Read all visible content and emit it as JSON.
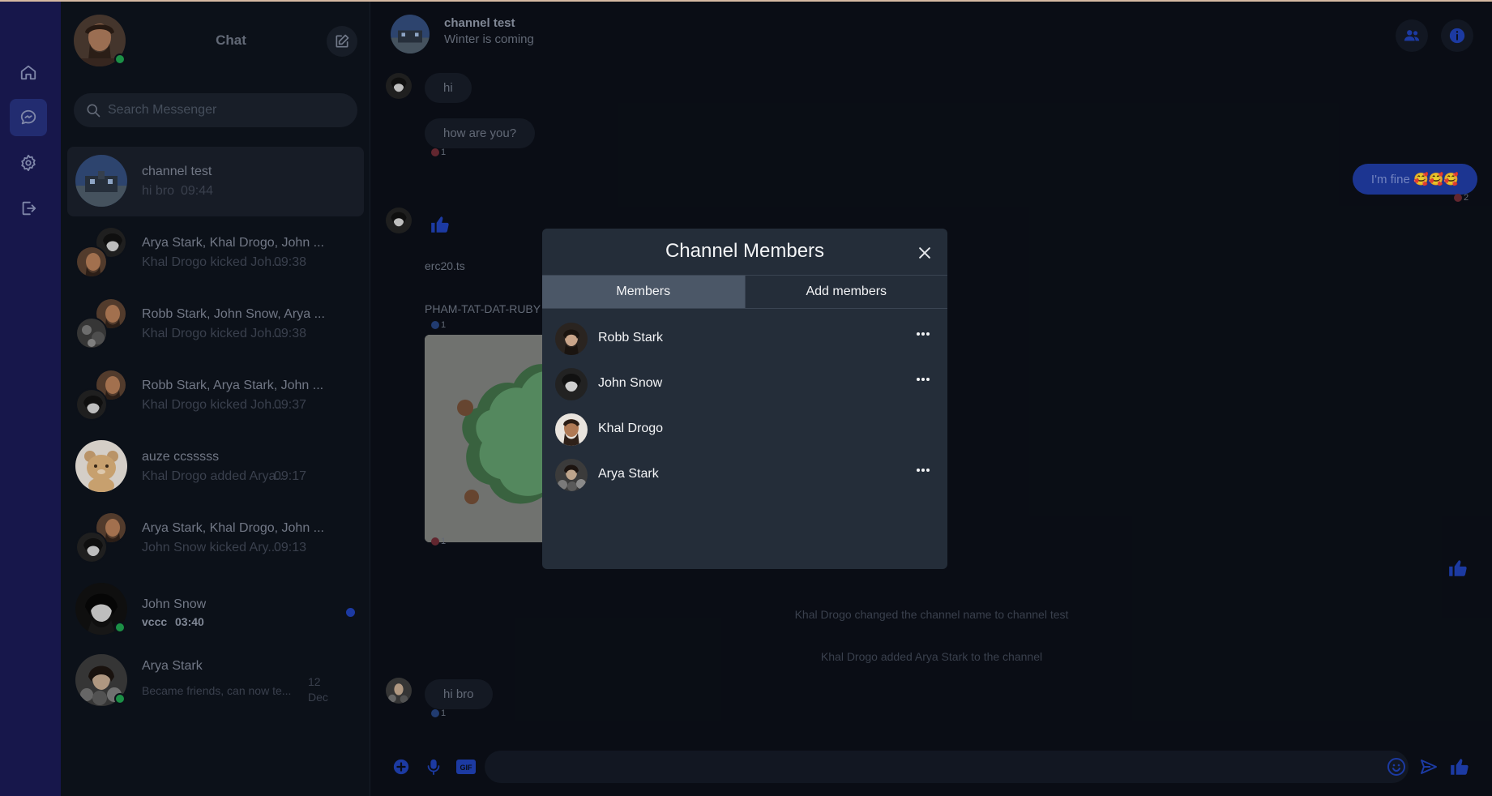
{
  "rail": {
    "items": [
      {
        "icon": "home-icon"
      },
      {
        "icon": "chat-icon",
        "active": true
      },
      {
        "icon": "gear-icon"
      },
      {
        "icon": "logout-icon"
      }
    ]
  },
  "sidebar": {
    "title": "Chat",
    "search_placeholder": "Search Messenger",
    "conversations": [
      {
        "name": "channel test",
        "last": "hi bro",
        "time": "09:44"
      },
      {
        "name": "Arya Stark, Khal Drogo, John ...",
        "last": "Khal Drogo kicked Joh...",
        "time": "09:38"
      },
      {
        "name": "Robb Stark, John Snow, Arya ...",
        "last": "Khal Drogo kicked Joh...",
        "time": "09:38"
      },
      {
        "name": "Robb Stark, Arya Stark, John ...",
        "last": "Khal Drogo kicked Joh...",
        "time": "09:37"
      },
      {
        "name": "auze ccsssss",
        "last": "Khal Drogo added Arya...",
        "time": "09:17"
      },
      {
        "name": "Arya Stark, Khal Drogo, John ...",
        "last": "John Snow kicked Ary...",
        "time": "09:13"
      },
      {
        "name": "John Snow",
        "last": "vccc",
        "time": "03:40"
      },
      {
        "name": "Arya Stark",
        "last": "Became friends, can now te...",
        "time_line1": "12",
        "time_line2": "Dec"
      }
    ]
  },
  "header": {
    "name": "channel test",
    "status": "Winter is coming"
  },
  "messages": {
    "m1": "hi",
    "m2": "how are you?",
    "m2_react": "1",
    "mine1": "I'm fine 🥰🥰🥰",
    "mine1_react": "2",
    "file1": "erc20.ts",
    "file2": "PHAM-TAT-DAT-RUBY",
    "file2_react": "1",
    "img_react": "1",
    "sys1": "Khal Drogo changed the channel name to channel test",
    "sys2": "Khal Drogo added Arya Stark to the channel",
    "last": "hi bro",
    "last_react": "1"
  },
  "modal": {
    "title": "Channel Members",
    "tabs": [
      "Members",
      "Add members"
    ],
    "members": [
      {
        "name": "Robb Stark",
        "has_menu": true
      },
      {
        "name": "John Snow",
        "has_menu": true
      },
      {
        "name": "Khal Drogo",
        "has_menu": false
      },
      {
        "name": "Arya Stark",
        "has_menu": true
      }
    ]
  },
  "colors": {
    "accent": "#1f3fb0",
    "online": "#1f9d4c",
    "rail": "#1a1a52"
  }
}
